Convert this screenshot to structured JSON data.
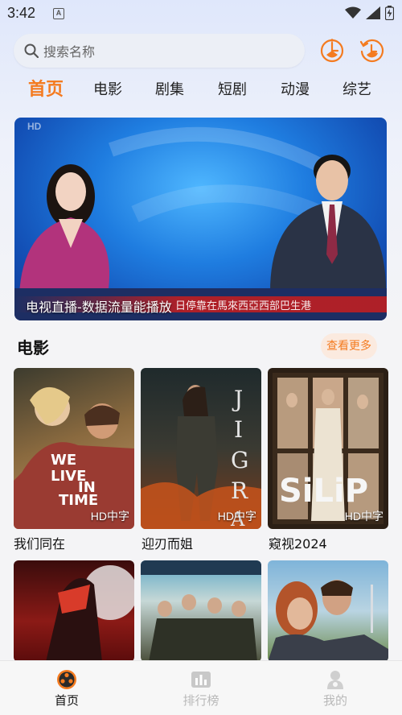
{
  "status_bar": {
    "time": "3:42",
    "notification": "A"
  },
  "search": {
    "placeholder": "搜索名称"
  },
  "header_icons": [
    "history-clock-icon",
    "history-refresh-icon"
  ],
  "tabs": [
    {
      "label": "首页",
      "active": true
    },
    {
      "label": "电影"
    },
    {
      "label": "剧集"
    },
    {
      "label": "短剧"
    },
    {
      "label": "动漫"
    },
    {
      "label": "综艺"
    }
  ],
  "banner": {
    "caption": "电视直播-数据流量能播放",
    "hd_tag": "HD",
    "ticker_text": "日停靠在馬來西亞西部巴生港"
  },
  "section": {
    "title": "电影",
    "more_label": "查看更多"
  },
  "movies": [
    {
      "title": "我们同在",
      "badge": "HD中字",
      "poster_text": "WE LIVE IN TIME"
    },
    {
      "title": "迎刃而姐",
      "badge": "HD中字",
      "poster_text": "JIGRA"
    },
    {
      "title": "窥视2024",
      "badge": "HD中字",
      "poster_text": "SiLiP"
    },
    {
      "title": "",
      "badge": ""
    },
    {
      "title": "",
      "badge": ""
    },
    {
      "title": "",
      "badge": ""
    }
  ],
  "bottom_nav": [
    {
      "label": "首页",
      "active": true,
      "icon": "home-film-reel-icon"
    },
    {
      "label": "排行榜",
      "active": false,
      "icon": "ranking-chart-icon"
    },
    {
      "label": "我的",
      "active": false,
      "icon": "profile-icon"
    }
  ],
  "colors": {
    "accent": "#f47b20",
    "inactive": "#b8b8b8"
  }
}
